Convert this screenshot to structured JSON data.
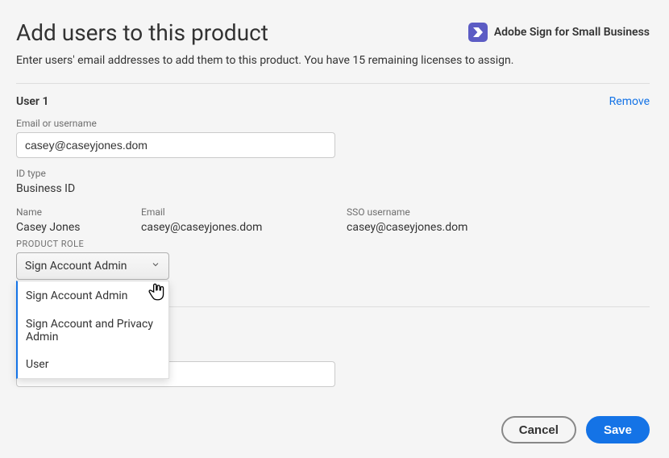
{
  "header": {
    "title": "Add users to this product",
    "product_name": "Adobe Sign for Small Business",
    "subtitle": "Enter users' email addresses to add them to this product. You have 15 remaining licenses to assign."
  },
  "user": {
    "section_label": "User 1",
    "remove_label": "Remove",
    "email_label": "Email or username",
    "email_value": "casey@caseyjones.dom",
    "id_type_label": "ID type",
    "id_type_value": "Business ID",
    "name_label": "Name",
    "name_value": "Casey Jones",
    "email_col_label": "Email",
    "email_col_value": "casey@caseyjones.dom",
    "sso_label": "SSO username",
    "sso_value": "casey@caseyjones.dom",
    "product_role_label": "PRODUCT ROLE",
    "selected_role": "Sign Account Admin",
    "role_options": {
      "opt0": "Sign Account Admin",
      "opt1": "Sign Account and Privacy Admin",
      "opt2": "User"
    }
  },
  "footer": {
    "cancel": "Cancel",
    "save": "Save"
  }
}
